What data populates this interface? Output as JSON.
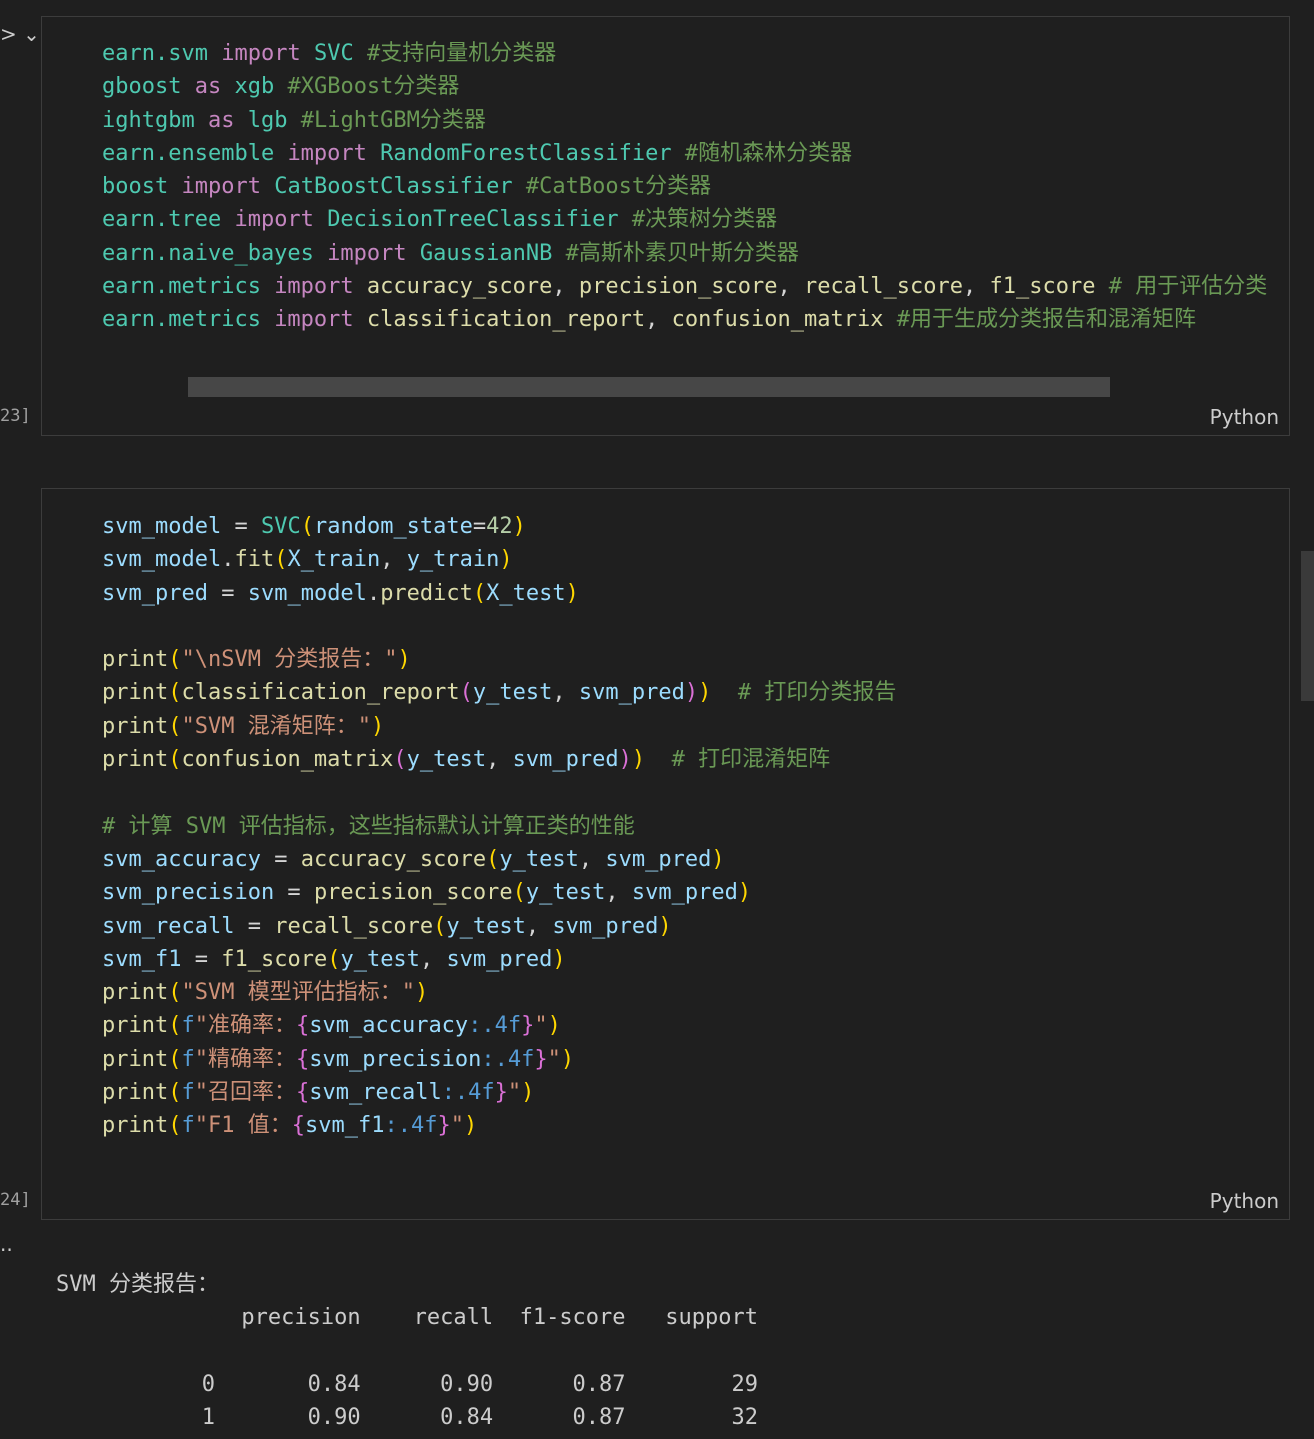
{
  "cells": [
    {
      "exec_count": "23]",
      "language": "Python",
      "lines": [
        [
          {
            "t": "earn.svm ",
            "c": "mod"
          },
          {
            "t": "import",
            "c": "kw"
          },
          {
            "t": " ",
            "c": "op"
          },
          {
            "t": "SVC",
            "c": "cls"
          },
          {
            "t": " #支持向量机分类器",
            "c": "cmt"
          }
        ],
        [
          {
            "t": "gboost ",
            "c": "mod"
          },
          {
            "t": "as",
            "c": "kw"
          },
          {
            "t": " ",
            "c": "op"
          },
          {
            "t": "xgb",
            "c": "cls"
          },
          {
            "t": " #XGBoost分类器",
            "c": "cmt"
          }
        ],
        [
          {
            "t": "ightgbm ",
            "c": "mod"
          },
          {
            "t": "as",
            "c": "kw"
          },
          {
            "t": " ",
            "c": "op"
          },
          {
            "t": "lgb",
            "c": "cls"
          },
          {
            "t": " #LightGBM分类器",
            "c": "cmt"
          }
        ],
        [
          {
            "t": "earn.ensemble ",
            "c": "mod"
          },
          {
            "t": "import",
            "c": "kw"
          },
          {
            "t": " ",
            "c": "op"
          },
          {
            "t": "RandomForestClassifier",
            "c": "cls"
          },
          {
            "t": " #随机森林分类器",
            "c": "cmt"
          }
        ],
        [
          {
            "t": "boost ",
            "c": "mod"
          },
          {
            "t": "import",
            "c": "kw"
          },
          {
            "t": " ",
            "c": "op"
          },
          {
            "t": "CatBoostClassifier",
            "c": "cls"
          },
          {
            "t": " #CatBoost分类器",
            "c": "cmt"
          }
        ],
        [
          {
            "t": "earn.tree ",
            "c": "mod"
          },
          {
            "t": "import",
            "c": "kw"
          },
          {
            "t": " ",
            "c": "op"
          },
          {
            "t": "DecisionTreeClassifier",
            "c": "cls"
          },
          {
            "t": " #决策树分类器",
            "c": "cmt"
          }
        ],
        [
          {
            "t": "earn.naive_bayes ",
            "c": "mod"
          },
          {
            "t": "import",
            "c": "kw"
          },
          {
            "t": " ",
            "c": "op"
          },
          {
            "t": "GaussianNB",
            "c": "cls"
          },
          {
            "t": " #高斯朴素贝叶斯分类器",
            "c": "cmt"
          }
        ],
        [
          {
            "t": "earn.metrics ",
            "c": "mod"
          },
          {
            "t": "import",
            "c": "kw"
          },
          {
            "t": " ",
            "c": "op"
          },
          {
            "t": "accuracy_score",
            "c": "fn"
          },
          {
            "t": ", ",
            "c": "op"
          },
          {
            "t": "precision_score",
            "c": "fn"
          },
          {
            "t": ", ",
            "c": "op"
          },
          {
            "t": "recall_score",
            "c": "fn"
          },
          {
            "t": ", ",
            "c": "op"
          },
          {
            "t": "f1_score",
            "c": "fn"
          },
          {
            "t": " # 用于评估分类",
            "c": "cmt"
          }
        ],
        [
          {
            "t": "earn.metrics ",
            "c": "mod"
          },
          {
            "t": "import",
            "c": "kw"
          },
          {
            "t": " ",
            "c": "op"
          },
          {
            "t": "classification_report",
            "c": "fn"
          },
          {
            "t": ", ",
            "c": "op"
          },
          {
            "t": "confusion_matrix",
            "c": "fn"
          },
          {
            "t": " #用于生成分类报告和混淆矩阵",
            "c": "cmt"
          }
        ]
      ]
    },
    {
      "exec_count": "24]",
      "language": "Python",
      "lines": [
        [
          {
            "t": "svm_model",
            "c": "var"
          },
          {
            "t": " = ",
            "c": "op"
          },
          {
            "t": "SVC",
            "c": "cls"
          },
          {
            "t": "(",
            "c": "p1"
          },
          {
            "t": "random_state",
            "c": "var"
          },
          {
            "t": "=",
            "c": "op"
          },
          {
            "t": "42",
            "c": "num"
          },
          {
            "t": ")",
            "c": "p1"
          }
        ],
        [
          {
            "t": "svm_model",
            "c": "var"
          },
          {
            "t": ".",
            "c": "op"
          },
          {
            "t": "fit",
            "c": "fn"
          },
          {
            "t": "(",
            "c": "p1"
          },
          {
            "t": "X_train",
            "c": "var"
          },
          {
            "t": ", ",
            "c": "op"
          },
          {
            "t": "y_train",
            "c": "var"
          },
          {
            "t": ")",
            "c": "p1"
          }
        ],
        [
          {
            "t": "svm_pred",
            "c": "var"
          },
          {
            "t": " = ",
            "c": "op"
          },
          {
            "t": "svm_model",
            "c": "var"
          },
          {
            "t": ".",
            "c": "op"
          },
          {
            "t": "predict",
            "c": "fn"
          },
          {
            "t": "(",
            "c": "p1"
          },
          {
            "t": "X_test",
            "c": "var"
          },
          {
            "t": ")",
            "c": "p1"
          }
        ],
        [],
        [
          {
            "t": "print",
            "c": "fn"
          },
          {
            "t": "(",
            "c": "p1"
          },
          {
            "t": "\"\\nSVM 分类报告：\"",
            "c": "str"
          },
          {
            "t": ")",
            "c": "p1"
          }
        ],
        [
          {
            "t": "print",
            "c": "fn"
          },
          {
            "t": "(",
            "c": "p1"
          },
          {
            "t": "classification_report",
            "c": "fn"
          },
          {
            "t": "(",
            "c": "p2"
          },
          {
            "t": "y_test",
            "c": "var"
          },
          {
            "t": ", ",
            "c": "op"
          },
          {
            "t": "svm_pred",
            "c": "var"
          },
          {
            "t": ")",
            "c": "p2"
          },
          {
            "t": ")",
            "c": "p1"
          },
          {
            "t": "  # 打印分类报告",
            "c": "cmt"
          }
        ],
        [
          {
            "t": "print",
            "c": "fn"
          },
          {
            "t": "(",
            "c": "p1"
          },
          {
            "t": "\"SVM 混淆矩阵：\"",
            "c": "str"
          },
          {
            "t": ")",
            "c": "p1"
          }
        ],
        [
          {
            "t": "print",
            "c": "fn"
          },
          {
            "t": "(",
            "c": "p1"
          },
          {
            "t": "confusion_matrix",
            "c": "fn"
          },
          {
            "t": "(",
            "c": "p2"
          },
          {
            "t": "y_test",
            "c": "var"
          },
          {
            "t": ", ",
            "c": "op"
          },
          {
            "t": "svm_pred",
            "c": "var"
          },
          {
            "t": ")",
            "c": "p2"
          },
          {
            "t": ")",
            "c": "p1"
          },
          {
            "t": "  # 打印混淆矩阵",
            "c": "cmt"
          }
        ],
        [],
        [
          {
            "t": "# 计算 SVM 评估指标，这些指标默认计算正类的性能",
            "c": "cmt"
          }
        ],
        [
          {
            "t": "svm_accuracy",
            "c": "var"
          },
          {
            "t": " = ",
            "c": "op"
          },
          {
            "t": "accuracy_score",
            "c": "fn"
          },
          {
            "t": "(",
            "c": "p1"
          },
          {
            "t": "y_test",
            "c": "var"
          },
          {
            "t": ", ",
            "c": "op"
          },
          {
            "t": "svm_pred",
            "c": "var"
          },
          {
            "t": ")",
            "c": "p1"
          }
        ],
        [
          {
            "t": "svm_precision",
            "c": "var"
          },
          {
            "t": " = ",
            "c": "op"
          },
          {
            "t": "precision_score",
            "c": "fn"
          },
          {
            "t": "(",
            "c": "p1"
          },
          {
            "t": "y_test",
            "c": "var"
          },
          {
            "t": ", ",
            "c": "op"
          },
          {
            "t": "svm_pred",
            "c": "var"
          },
          {
            "t": ")",
            "c": "p1"
          }
        ],
        [
          {
            "t": "svm_recall",
            "c": "var"
          },
          {
            "t": " = ",
            "c": "op"
          },
          {
            "t": "recall_score",
            "c": "fn"
          },
          {
            "t": "(",
            "c": "p1"
          },
          {
            "t": "y_test",
            "c": "var"
          },
          {
            "t": ", ",
            "c": "op"
          },
          {
            "t": "svm_pred",
            "c": "var"
          },
          {
            "t": ")",
            "c": "p1"
          }
        ],
        [
          {
            "t": "svm_f1",
            "c": "var"
          },
          {
            "t": " = ",
            "c": "op"
          },
          {
            "t": "f1_score",
            "c": "fn"
          },
          {
            "t": "(",
            "c": "p1"
          },
          {
            "t": "y_test",
            "c": "var"
          },
          {
            "t": ", ",
            "c": "op"
          },
          {
            "t": "svm_pred",
            "c": "var"
          },
          {
            "t": ")",
            "c": "p1"
          }
        ],
        [
          {
            "t": "print",
            "c": "fn"
          },
          {
            "t": "(",
            "c": "p1"
          },
          {
            "t": "\"SVM 模型评估指标：\"",
            "c": "str"
          },
          {
            "t": ")",
            "c": "p1"
          }
        ],
        [
          {
            "t": "print",
            "c": "fn"
          },
          {
            "t": "(",
            "c": "p1"
          },
          {
            "t": "f",
            "c": "fpre"
          },
          {
            "t": "\"准确率：",
            "c": "str"
          },
          {
            "t": "{",
            "c": "p2"
          },
          {
            "t": "svm_accuracy",
            "c": "var"
          },
          {
            "t": ":.4f",
            "c": "fmt"
          },
          {
            "t": "}",
            "c": "p2"
          },
          {
            "t": "\"",
            "c": "str"
          },
          {
            "t": ")",
            "c": "p1"
          }
        ],
        [
          {
            "t": "print",
            "c": "fn"
          },
          {
            "t": "(",
            "c": "p1"
          },
          {
            "t": "f",
            "c": "fpre"
          },
          {
            "t": "\"精确率：",
            "c": "str"
          },
          {
            "t": "{",
            "c": "p2"
          },
          {
            "t": "svm_precision",
            "c": "var"
          },
          {
            "t": ":.4f",
            "c": "fmt"
          },
          {
            "t": "}",
            "c": "p2"
          },
          {
            "t": "\"",
            "c": "str"
          },
          {
            "t": ")",
            "c": "p1"
          }
        ],
        [
          {
            "t": "print",
            "c": "fn"
          },
          {
            "t": "(",
            "c": "p1"
          },
          {
            "t": "f",
            "c": "fpre"
          },
          {
            "t": "\"召回率：",
            "c": "str"
          },
          {
            "t": "{",
            "c": "p2"
          },
          {
            "t": "svm_recall",
            "c": "var"
          },
          {
            "t": ":.4f",
            "c": "fmt"
          },
          {
            "t": "}",
            "c": "p2"
          },
          {
            "t": "\"",
            "c": "str"
          },
          {
            "t": ")",
            "c": "p1"
          }
        ],
        [
          {
            "t": "print",
            "c": "fn"
          },
          {
            "t": "(",
            "c": "p1"
          },
          {
            "t": "f",
            "c": "fpre"
          },
          {
            "t": "\"F1 值：",
            "c": "str"
          },
          {
            "t": "{",
            "c": "p2"
          },
          {
            "t": "svm_f1",
            "c": "var"
          },
          {
            "t": ":.4f",
            "c": "fmt"
          },
          {
            "t": "}",
            "c": "p2"
          },
          {
            "t": "\"",
            "c": "str"
          },
          {
            "t": ")",
            "c": "p1"
          }
        ]
      ]
    }
  ],
  "output": {
    "more_indicator": "..",
    "lines": [
      "SVM 分类报告：",
      "              precision    recall  f1-score   support",
      "",
      "           0       0.84      0.90      0.87        29",
      "           1       0.90      0.84      0.87        32"
    ]
  },
  "ui": {
    "collapse_chevron": "> ⌄"
  }
}
